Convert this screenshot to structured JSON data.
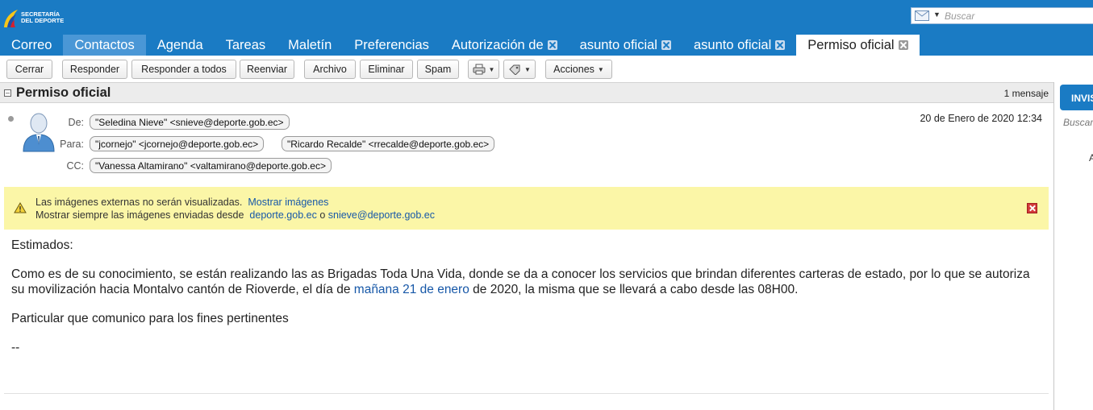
{
  "logo": {
    "line1": "SECRETARÍA",
    "line2": "DEL DEPORTE"
  },
  "search": {
    "placeholder": "Buscar"
  },
  "tabs": [
    {
      "label": "Correo"
    },
    {
      "label": "Contactos"
    },
    {
      "label": "Agenda"
    },
    {
      "label": "Tareas"
    },
    {
      "label": "Maletín"
    },
    {
      "label": "Preferencias"
    },
    {
      "label": "Autorización de"
    },
    {
      "label": "asunto oficial"
    },
    {
      "label": "asunto oficial"
    },
    {
      "label": "Permiso oficial"
    }
  ],
  "toolbar": {
    "close": "Cerrar",
    "reply": "Responder",
    "reply_all": "Responder a todos",
    "forward": "Reenviar",
    "archive": "Archivo",
    "delete": "Eliminar",
    "spam": "Spam",
    "actions": "Acciones"
  },
  "conversation": {
    "title": "Permiso oficial",
    "count": "1 mensaje"
  },
  "message": {
    "labels": {
      "from": "De:",
      "to": "Para:",
      "cc": "CC:"
    },
    "from": "\"Seledina Nieve\" <snieve@deporte.gob.ec>",
    "to": [
      "\"jcornejo\" <jcornejo@deporte.gob.ec>",
      "\"Ricardo Recalde\" <rrecalde@deporte.gob.ec>"
    ],
    "cc": "\"Vanessa Altamirano\" <valtamirano@deporte.gob.ec>",
    "date": "20 de Enero de 2020 12:34"
  },
  "warning": {
    "text1": "Las imágenes externas no serán visualizadas.",
    "show_link": "Mostrar imágenes",
    "text2": "Mostrar siempre las imágenes enviadas desde",
    "domain_link": "deporte.gob.ec",
    "or": "o",
    "sender_link": "snieve@deporte.gob.ec"
  },
  "body": {
    "greeting": "Estimados:",
    "para1_part1": "Como es de su conocimiento, se están realizando  las as Brigadas Toda Una Vida, donde se da a conocer los servicios que brindan diferentes carteras de estado, por lo que se autoriza su movilización hacia Montalvo cantón de Rioverde, el día de",
    "para1_link": "mañana 21 de enero",
    "para1_part2": "de 2020, la misma que se llevará a cabo desde las 08H00.",
    "para2": "Particular que comunico para los fines pertinentes",
    "signature": "--"
  },
  "right_panel": {
    "button": "INVIS",
    "search": "Buscar",
    "letter": "A"
  },
  "colors": {
    "header_blue": "#1a7bc4",
    "tab_highlight": "#4a97d6",
    "warning_bg": "#fbf6a7",
    "link": "#1758a8"
  }
}
